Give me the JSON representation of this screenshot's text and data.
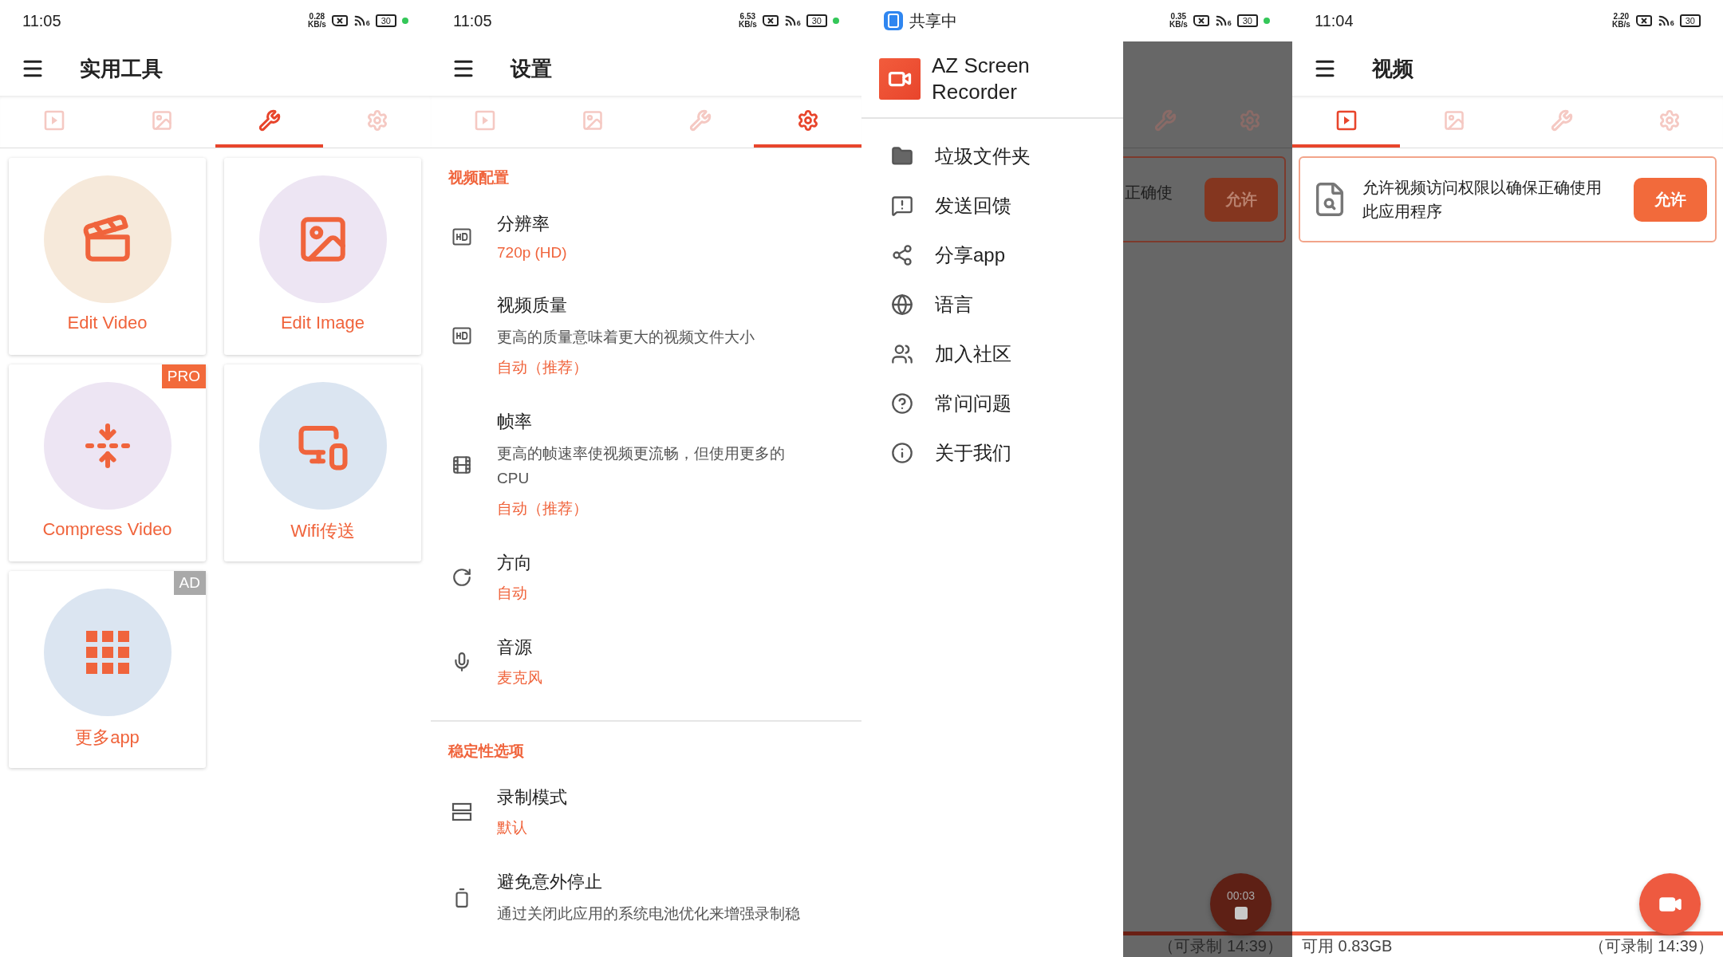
{
  "screens": [
    {
      "kind": "tools",
      "status_bar": {
        "time": "11:05",
        "speed": "0.28",
        "speed_unit": "KB/s",
        "signal": "6",
        "battery": "30",
        "privacy_dot": true
      },
      "title": "实用工具",
      "tabs": [
        {
          "kind": "video",
          "selected": false
        },
        {
          "kind": "image",
          "selected": false
        },
        {
          "kind": "tools",
          "selected": true
        },
        {
          "kind": "settings",
          "selected": false
        }
      ],
      "tools": [
        {
          "label": "Edit Video",
          "kind": "clapper",
          "color": "#f6e9da"
        },
        {
          "label": "Edit Image",
          "kind": "image",
          "color": "#ede5f3"
        },
        {
          "label": "Compress Video",
          "kind": "compress",
          "color": "#ede5f3",
          "badge": {
            "text": "PRO",
            "kind": "pro"
          }
        },
        {
          "label": "Wifi传送",
          "kind": "wifi",
          "color": "#dbe5f1"
        },
        {
          "label": "更多app",
          "kind": "grid",
          "color": "#dbe5f1",
          "badge": {
            "text": "AD",
            "kind": "ad"
          }
        }
      ]
    },
    {
      "kind": "settings",
      "status_bar": {
        "time": "11:05",
        "speed": "6.53",
        "speed_unit": "KB/s",
        "signal": "6",
        "battery": "30",
        "privacy_dot": true
      },
      "title": "设置",
      "tabs": [
        {
          "kind": "video",
          "selected": false
        },
        {
          "kind": "image",
          "selected": false
        },
        {
          "kind": "tools",
          "selected": false
        },
        {
          "kind": "settings",
          "selected": true
        }
      ],
      "sections": [
        {
          "title": "视频配置",
          "items": [
            {
              "kind": "hd",
              "title": "分辨率",
              "value": "720p (HD)"
            },
            {
              "kind": "hd",
              "title": "视频质量",
              "description": "更高的质量意味着更大的视频文件大小",
              "value": "自动（推荐）"
            },
            {
              "kind": "film",
              "title": "帧率",
              "description": "更高的帧速率使视频更流畅，但使用更多的CPU",
              "value": "自动（推荐）"
            },
            {
              "kind": "rotate",
              "title": "方向",
              "value": "自动"
            },
            {
              "kind": "mic",
              "title": "音源",
              "value": "麦克风"
            }
          ]
        },
        {
          "title": "稳定性选项",
          "items": [
            {
              "kind": "rows",
              "title": "录制模式",
              "value": "默认"
            },
            {
              "kind": "battery",
              "title": "避免意外停止",
              "description": "通过关闭此应用的系统电池优化来增强录制稳"
            }
          ]
        }
      ]
    },
    {
      "kind": "drawer",
      "status_bar": {
        "sharing": "共享中",
        "speed": "0.35",
        "speed_unit": "KB/s",
        "signal": "6",
        "battery": "30",
        "privacy_dot": true
      },
      "drawer": {
        "app_name": "AZ Screen Recorder",
        "items": [
          {
            "kind": "folder",
            "label": "垃圾文件夹"
          },
          {
            "kind": "feedback",
            "label": "发送回馈"
          },
          {
            "kind": "share",
            "label": "分享app"
          },
          {
            "kind": "globe",
            "label": "语言"
          },
          {
            "kind": "community",
            "label": "加入社区"
          },
          {
            "kind": "help",
            "label": "常问问题"
          },
          {
            "kind": "info",
            "label": "关于我们"
          }
        ]
      },
      "behind": {
        "tabs": [
          {
            "kind": "tools",
            "selected": false
          },
          {
            "kind": "settings",
            "selected": false
          }
        ],
        "card_text": "正确使",
        "button": "允许",
        "fab": {
          "kind": "recording",
          "timer": "00:03"
        },
        "footer_right": "（可录制 14:39）"
      }
    },
    {
      "kind": "video",
      "status_bar": {
        "time": "11:04",
        "speed": "2.20",
        "speed_unit": "KB/s",
        "signal": "6",
        "battery": "30",
        "privacy_dot": false
      },
      "title": "视频",
      "tabs": [
        {
          "kind": "video",
          "selected": true
        },
        {
          "kind": "image",
          "selected": false
        },
        {
          "kind": "tools",
          "selected": false
        },
        {
          "kind": "settings",
          "selected": false
        }
      ],
      "permission": {
        "text": "允许视频访问权限以确保正确使用此应用程序",
        "button": "允许"
      },
      "fab": {
        "kind": "idle"
      },
      "footer": {
        "left": "可用 0.83GB",
        "right": "（可录制 14:39）"
      }
    }
  ]
}
